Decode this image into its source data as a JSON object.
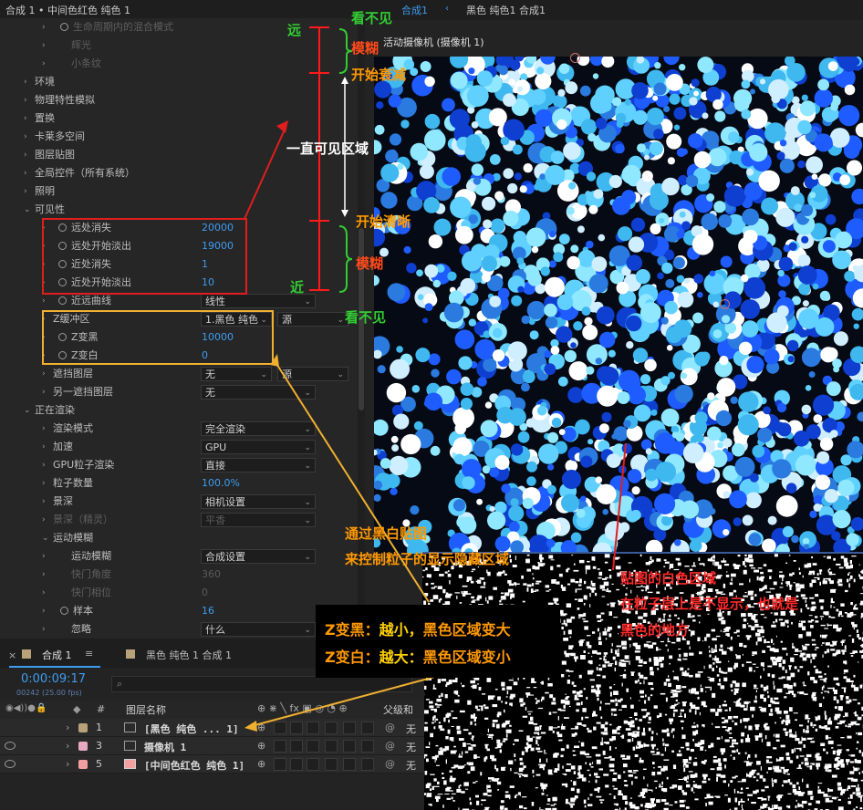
{
  "panel_header": {
    "title": "合成 1 • 中间色红色 纯色 1",
    "viewer_tab_active": "合成1",
    "viewer_tab_other": "黑色 纯色1 合成1",
    "camera_label": "活动摄像机 (摄像机 1)"
  },
  "effect_rows": [
    {
      "label": "生命周期内的混合模式",
      "dim": true,
      "indent": 3,
      "stopwatch": true
    },
    {
      "label": "辉光",
      "dim": true,
      "indent": 3
    },
    {
      "label": "小条纹",
      "dim": true,
      "indent": 3
    },
    {
      "label": "环境",
      "indent": 1
    },
    {
      "label": "物理特性模拟",
      "indent": 1
    },
    {
      "label": "置换",
      "indent": 1
    },
    {
      "label": "卡莱多空间",
      "indent": 1
    },
    {
      "label": "图层贴图",
      "indent": 1
    },
    {
      "label": "全局控件（所有系统）",
      "indent": 1
    },
    {
      "label": "照明",
      "indent": 1
    },
    {
      "label": "可见性",
      "indent": 1,
      "open": true
    },
    {
      "label": "远处消失",
      "indent": 2,
      "stopwatch": true,
      "value": "20000"
    },
    {
      "label": "远处开始淡出",
      "indent": 2,
      "stopwatch": true,
      "value": "19000"
    },
    {
      "label": "近处消失",
      "indent": 2,
      "stopwatch": true,
      "value": "1"
    },
    {
      "label": "近处开始淡出",
      "indent": 2,
      "stopwatch": true,
      "value": "10"
    },
    {
      "label": "近远曲线",
      "indent": 2,
      "stopwatch": true,
      "dropdown": "线性"
    },
    {
      "label": "Z缓冲区",
      "indent": 2,
      "dropdown": "1.黑色 纯色",
      "dropdown2": "源"
    },
    {
      "label": "Z变黑",
      "indent": 2,
      "stopwatch": true,
      "value": "10000"
    },
    {
      "label": "Z变白",
      "indent": 2,
      "stopwatch": true,
      "value": "0"
    },
    {
      "label": "遮挡图层",
      "indent": 2,
      "dropdown": "无",
      "dropdown2": "源"
    },
    {
      "label": "另一遮挡图层",
      "indent": 2,
      "dropdown": "无"
    },
    {
      "label": "正在渲染",
      "indent": 1,
      "open": true
    },
    {
      "label": "渲染模式",
      "indent": 2,
      "dropdown": "完全渲染"
    },
    {
      "label": "加速",
      "indent": 2,
      "dropdown": "GPU"
    },
    {
      "label": "GPU粒子渲染",
      "indent": 2,
      "dropdown": "直接"
    },
    {
      "label": "粒子数量",
      "indent": 2,
      "value": "100.0%"
    },
    {
      "label": "景深",
      "indent": 2,
      "dropdown": "相机设置"
    },
    {
      "label": "景深（精灵）",
      "indent": 2,
      "dim": true,
      "dropdown": "平香",
      "dropdim": true
    },
    {
      "label": "运动模糊",
      "indent": 2,
      "open": true
    },
    {
      "label": "运动模糊",
      "indent": 3,
      "dropdown": "合成设置"
    },
    {
      "label": "快门角度",
      "indent": 3,
      "dim": true,
      "value": "360",
      "valdim": true
    },
    {
      "label": "快门相位",
      "indent": 3,
      "dim": true,
      "value": "0",
      "valdim": true
    },
    {
      "label": "样本",
      "indent": 3,
      "stopwatch": true,
      "value": "16"
    },
    {
      "label": "忽略",
      "indent": 3,
      "dropdown": "什么"
    }
  ],
  "timeline": {
    "tab": "合成 1",
    "tab2": "黑色 纯色 1 合成 1",
    "timecode": "0:00:09:17",
    "timecode_sub": "00242 (25.00 fps)",
    "search_placeholder": "",
    "col_num": "#",
    "col_name": "图层名称",
    "col_parent": "父级和",
    "layers": [
      {
        "idx": "1",
        "name": "[黑色 纯色 ... 1]",
        "color": "#b8a27a",
        "parent": "无"
      },
      {
        "idx": "3",
        "name": "摄像机 1",
        "color": "#e8a9c0",
        "parent": "无"
      },
      {
        "idx": "5",
        "name": "[中间色红色 纯色 1]",
        "color": "#f4a0a0",
        "parent": "无"
      }
    ]
  },
  "annotations": {
    "far": "远",
    "near": "近",
    "invisible_top": "看不见",
    "invisible_bottom": "看不见",
    "blur_top": "模糊",
    "blur_bottom": "模糊",
    "fade_start": "开始衰减",
    "always_visible": "一直可见区域",
    "clear_start": "开始清晰",
    "control_line1": "通过黑白贴图",
    "control_line2": "来控制粒子的显示隐藏区域",
    "white_area_line1": "贴图的白色区域",
    "white_area_line2": "在粒子层上是不显示，也就是",
    "white_area_line3": "黑色的地方",
    "zblack_a": "Z变黑：",
    "zblack_b": "越小，",
    "zblack_c": "黑色区域变大",
    "zwhite_a": "Z变白：",
    "zwhite_b": "越大：",
    "zwhite_c": "黑色区域变小"
  }
}
